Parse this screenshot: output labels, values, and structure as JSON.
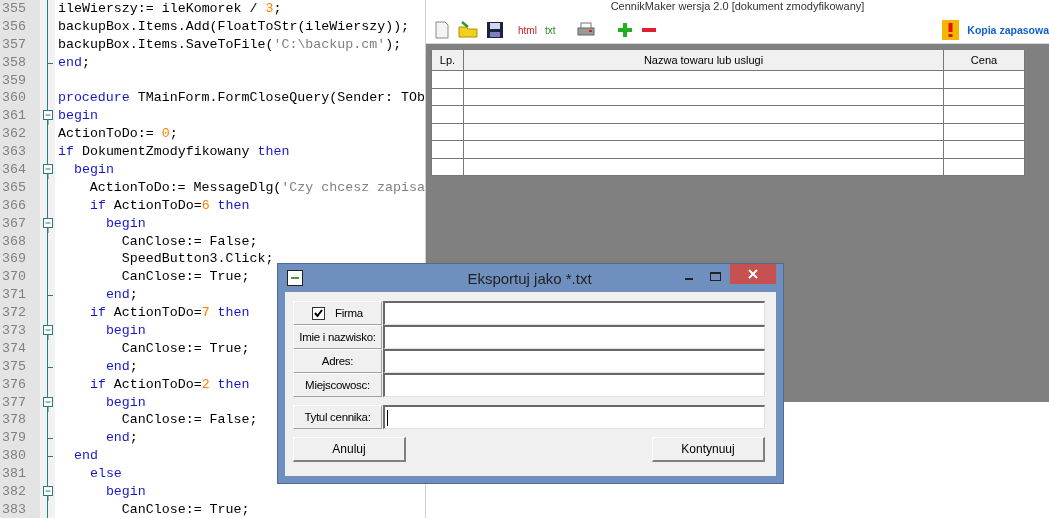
{
  "editor": {
    "lines": [
      {
        "number": "355",
        "fold_start": false,
        "fold_end": false,
        "tokens": [
          {
            "kind": "plain",
            "text": "ileWierszy:= ileKomorek / "
          },
          {
            "kind": "number",
            "text": "3"
          },
          {
            "kind": "plain",
            "text": ";"
          }
        ]
      },
      {
        "number": "356",
        "fold_start": false,
        "fold_end": false,
        "tokens": [
          {
            "kind": "plain",
            "text": "backupBox.Items.Add(FloatToStr(ileWierszy));"
          }
        ]
      },
      {
        "number": "357",
        "fold_start": false,
        "fold_end": false,
        "tokens": [
          {
            "kind": "plain",
            "text": "backupBox.Items.SaveToFile("
          },
          {
            "kind": "string",
            "text": "'C:\\backup.cm'"
          },
          {
            "kind": "plain",
            "text": ");"
          }
        ]
      },
      {
        "number": "358",
        "fold_start": false,
        "fold_end": true,
        "tokens": [
          {
            "kind": "keyword",
            "text": "end"
          },
          {
            "kind": "plain",
            "text": ";"
          }
        ]
      },
      {
        "number": "359",
        "fold_start": false,
        "fold_end": false
      },
      {
        "number": "360",
        "fold_start": false,
        "fold_end": false,
        "tokens": [
          {
            "kind": "keyword",
            "text": "procedure"
          },
          {
            "kind": "plain",
            "text": " TMainForm.FormCloseQuery(Sender: TOb"
          }
        ]
      },
      {
        "number": "361",
        "fold_start": true,
        "fold_end": false,
        "tokens": [
          {
            "kind": "keyword",
            "text": "begin"
          }
        ]
      },
      {
        "number": "362",
        "fold_start": false,
        "fold_end": false,
        "tokens": [
          {
            "kind": "plain",
            "text": "ActionToDo:= "
          },
          {
            "kind": "number",
            "text": "0"
          },
          {
            "kind": "plain",
            "text": ";"
          }
        ]
      },
      {
        "number": "363",
        "fold_start": false,
        "fold_end": false,
        "tokens": [
          {
            "kind": "keyword",
            "text": "if"
          },
          {
            "kind": "plain",
            "text": " DokumentZmodyfikowany "
          },
          {
            "kind": "keyword",
            "text": "then"
          }
        ]
      },
      {
        "number": "364",
        "fold_start": true,
        "fold_end": false,
        "tokens": [
          {
            "kind": "keyword",
            "text": "  begin"
          }
        ]
      },
      {
        "number": "365",
        "fold_start": false,
        "fold_end": false,
        "tokens": [
          {
            "kind": "plain",
            "text": "    ActionToDo:= MessageDlg("
          },
          {
            "kind": "string",
            "text": "'Czy chcesz zapisa"
          }
        ]
      },
      {
        "number": "366",
        "fold_start": false,
        "fold_end": false,
        "tokens": [
          {
            "kind": "keyword",
            "text": "    if"
          },
          {
            "kind": "plain",
            "text": " ActionToDo="
          },
          {
            "kind": "number",
            "text": "6"
          },
          {
            "kind": "keyword",
            "text": " then"
          }
        ]
      },
      {
        "number": "367",
        "fold_start": true,
        "fold_end": false,
        "tokens": [
          {
            "kind": "keyword",
            "text": "      begin"
          }
        ]
      },
      {
        "number": "368",
        "fold_start": false,
        "fold_end": false,
        "tokens": [
          {
            "kind": "plain",
            "text": "        CanClose:= False;"
          }
        ]
      },
      {
        "number": "369",
        "fold_start": false,
        "fold_end": false,
        "tokens": [
          {
            "kind": "plain",
            "text": "        SpeedButton3.Click;"
          }
        ]
      },
      {
        "number": "370",
        "fold_start": false,
        "fold_end": false,
        "tokens": [
          {
            "kind": "plain",
            "text": "        CanClose:= True;"
          }
        ]
      },
      {
        "number": "371",
        "fold_start": false,
        "fold_end": true,
        "tokens": [
          {
            "kind": "keyword",
            "text": "      end"
          },
          {
            "kind": "plain",
            "text": ";"
          }
        ]
      },
      {
        "number": "372",
        "fold_start": false,
        "fold_end": false,
        "tokens": [
          {
            "kind": "keyword",
            "text": "    if"
          },
          {
            "kind": "plain",
            "text": " ActionToDo="
          },
          {
            "kind": "number",
            "text": "7"
          },
          {
            "kind": "keyword",
            "text": " then"
          }
        ]
      },
      {
        "number": "373",
        "fold_start": true,
        "fold_end": false,
        "tokens": [
          {
            "kind": "keyword",
            "text": "      begin"
          }
        ]
      },
      {
        "number": "374",
        "fold_start": false,
        "fold_end": false,
        "tokens": [
          {
            "kind": "plain",
            "text": "        CanClose:= True;"
          }
        ]
      },
      {
        "number": "375",
        "fold_start": false,
        "fold_end": true,
        "tokens": [
          {
            "kind": "keyword",
            "text": "      end"
          },
          {
            "kind": "plain",
            "text": ";"
          }
        ]
      },
      {
        "number": "376",
        "fold_start": false,
        "fold_end": false,
        "tokens": [
          {
            "kind": "keyword",
            "text": "    if"
          },
          {
            "kind": "plain",
            "text": " ActionToDo="
          },
          {
            "kind": "number",
            "text": "2"
          },
          {
            "kind": "keyword",
            "text": " then"
          }
        ]
      },
      {
        "number": "377",
        "fold_start": true,
        "fold_end": false,
        "tokens": [
          {
            "kind": "keyword",
            "text": "      begin"
          }
        ]
      },
      {
        "number": "378",
        "fold_start": false,
        "fold_end": false,
        "tokens": [
          {
            "kind": "plain",
            "text": "        CanClose:= False;"
          }
        ]
      },
      {
        "number": "379",
        "fold_start": false,
        "fold_end": true,
        "tokens": [
          {
            "kind": "keyword",
            "text": "      end"
          },
          {
            "kind": "plain",
            "text": ";"
          }
        ]
      },
      {
        "number": "380",
        "fold_start": false,
        "fold_end": true,
        "tokens": [
          {
            "kind": "keyword",
            "text": "  end"
          }
        ]
      },
      {
        "number": "381",
        "fold_start": false,
        "fold_end": false,
        "tokens": [
          {
            "kind": "keyword",
            "text": "    else"
          }
        ]
      },
      {
        "number": "382",
        "fold_start": true,
        "fold_end": false,
        "tokens": [
          {
            "kind": "keyword",
            "text": "      begin"
          }
        ]
      },
      {
        "number": "383",
        "fold_start": false,
        "fold_end": false,
        "tokens": [
          {
            "kind": "plain",
            "text": "        CanClose:= True;"
          }
        ]
      }
    ]
  },
  "app": {
    "title": "CennikMaker wersja 2.0 [dokument zmodyfikowany]",
    "toolbar": {
      "html_label": "html",
      "txt_label": "txt"
    },
    "backup_link": "Kopia zapasowa",
    "table": {
      "columns": [
        "Lp.",
        "Nazwa towaru lub uslugi",
        "Cena"
      ]
    }
  },
  "dialog": {
    "title": "Eksportuj jako *.txt",
    "fields": [
      {
        "kind": "checkbox",
        "label": "Firma",
        "checked": true,
        "focused": false
      },
      {
        "kind": "label",
        "label": "Imie i nazwisko:",
        "focused": false
      },
      {
        "kind": "label",
        "label": "Adres:",
        "focused": false
      },
      {
        "kind": "label",
        "label": "Miejscowosc:",
        "focused": false
      },
      {
        "kind": "label",
        "label": "Tytul cennika:",
        "focused": true
      }
    ],
    "buttons": [
      "Anuluj",
      "Kontynuuj"
    ]
  }
}
